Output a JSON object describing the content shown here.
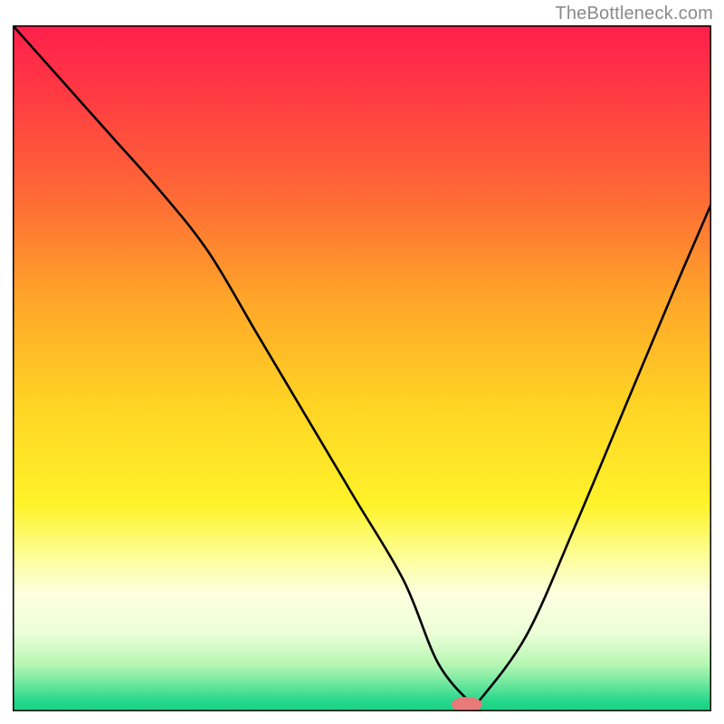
{
  "watermark": "TheBottleneck.com",
  "chart_data": {
    "type": "line",
    "title": "",
    "xlabel": "",
    "ylabel": "",
    "xlim": [
      0,
      100
    ],
    "ylim": [
      0,
      100
    ],
    "grid": false,
    "legend_position": "none",
    "series": [
      {
        "name": "curve",
        "x": [
          0,
          7,
          14,
          21,
          28,
          35,
          42,
          49,
          56,
          60.9,
          65.8,
          66.5,
          73.5,
          80.5,
          87.5,
          94.5,
          100
        ],
        "values": [
          100,
          92,
          84,
          76,
          67,
          55,
          43,
          31,
          19,
          7,
          1,
          1.2,
          11,
          27,
          44,
          61,
          74
        ]
      }
    ],
    "marker": {
      "name": "pill",
      "x": 65,
      "y": 1,
      "color": "#e87a7a",
      "rx": 2.2,
      "ry": 1.1
    },
    "gradient_stops": [
      {
        "pos": 0.0,
        "color": "#ff1f4b"
      },
      {
        "pos": 0.1,
        "color": "#ff3a43"
      },
      {
        "pos": 0.25,
        "color": "#ff6a36"
      },
      {
        "pos": 0.4,
        "color": "#ffa629"
      },
      {
        "pos": 0.55,
        "color": "#ffd324"
      },
      {
        "pos": 0.7,
        "color": "#fff32a"
      },
      {
        "pos": 0.78,
        "color": "#fcffa0"
      },
      {
        "pos": 0.83,
        "color": "#fdffe0"
      },
      {
        "pos": 0.885,
        "color": "#ecffd8"
      },
      {
        "pos": 0.93,
        "color": "#b9f7b4"
      },
      {
        "pos": 0.958,
        "color": "#72e8a0"
      },
      {
        "pos": 0.985,
        "color": "#26d88b"
      },
      {
        "pos": 1.0,
        "color": "#18d084"
      }
    ],
    "curve_stroke": "#000000",
    "curve_width": 2.6,
    "frame_stroke": "#000000",
    "frame_width": 3
  }
}
